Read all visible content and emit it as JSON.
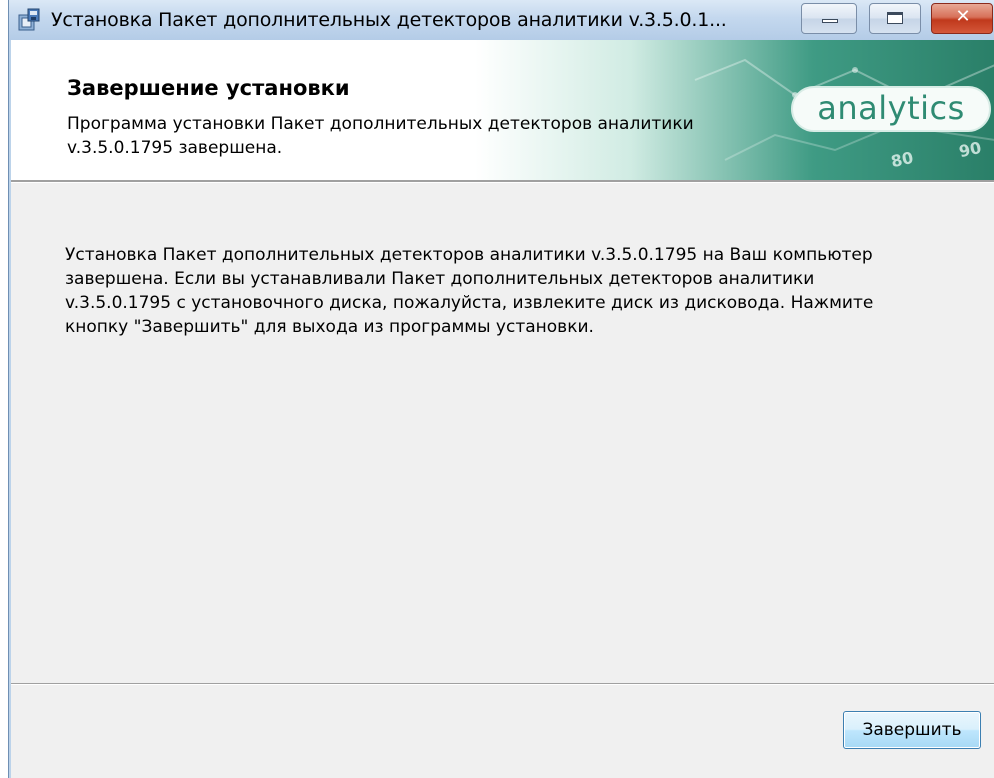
{
  "window": {
    "title": "Установка Пакет дополнительных детекторов аналитики v.3.5.0.1...",
    "close_glyph": "✕"
  },
  "header": {
    "title": "Завершение установки",
    "subtitle": "Программа установки Пакет дополнительных детекторов аналитики v.3.5.0.1795 завершена.",
    "logo_text": "analytics",
    "banner_numbers": [
      "80",
      "90"
    ]
  },
  "body": {
    "message": "Установка Пакет дополнительных детекторов аналитики v.3.5.0.1795 на Ваш компьютер завершена. Если вы устанавливали Пакет дополнительных детекторов аналитики v.3.5.0.1795 с установочного диска, пожалуйста, извлеките диск из дисковода. Нажмите кнопку \"Завершить\" для выхода из программы установки."
  },
  "footer": {
    "finish_label": "Завершить"
  },
  "icons": {
    "app": "installer-icon",
    "minimize": "minimize-icon",
    "maximize": "maximize-icon",
    "close": "close-icon"
  },
  "colors": {
    "accent": "#2f8b73",
    "titlebar": "#c4d8ee",
    "close_button": "#c0391c"
  }
}
